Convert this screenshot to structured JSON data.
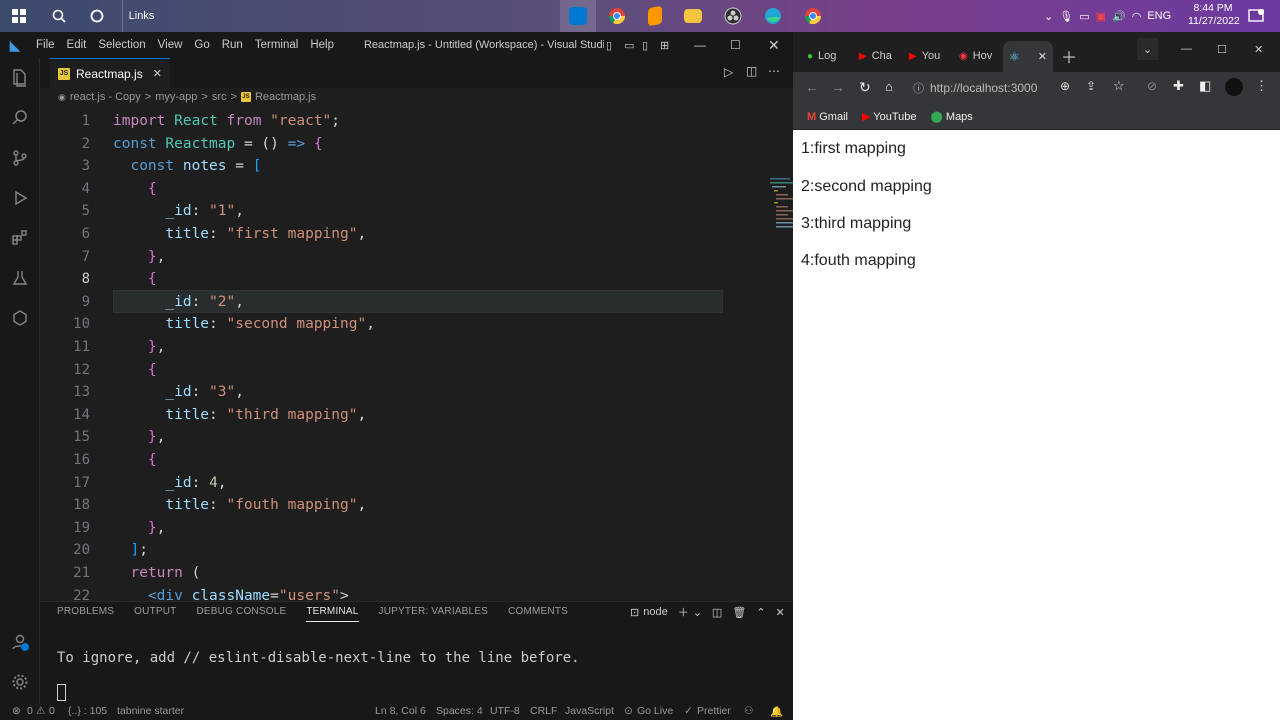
{
  "taskbar": {
    "search_label": "Links",
    "time": "8:44 PM",
    "date": "11/27/2022",
    "lang": "ENG"
  },
  "vscode": {
    "menu": [
      "File",
      "Edit",
      "Selection",
      "View",
      "Go",
      "Run",
      "Terminal",
      "Help"
    ],
    "title": "Reactmap.js - Untitled (Workspace) - Visual Studio C...",
    "tab_label": "Reactmap.js",
    "breadcrumbs": [
      "react.js - Copy",
      ">",
      "myy-app",
      ">",
      "src",
      ">",
      "Reactmap.js"
    ],
    "panel_tabs": [
      "PROBLEMS",
      "OUTPUT",
      "DEBUG CONSOLE",
      "TERMINAL",
      "JUPYTER: VARIABLES",
      "COMMENTS"
    ],
    "terminal_shell": "node",
    "terminal_output": "To ignore, add // eslint-disable-next-line to the line before.",
    "status": {
      "errors": "0",
      "warnings": "0",
      "braces": "{..} : 105",
      "tabnine": "tabnine starter",
      "position": "Ln 8, Col 6",
      "spaces": "Spaces: 4",
      "encoding": "UTF-8",
      "eol": "CRLF",
      "language": "JavaScript",
      "golive": "Go Live",
      "prettier": "Prettier"
    },
    "code_lines": [
      "import React from \"react\";",
      "const Reactmap = () => {",
      "  const notes = [",
      "    {",
      "      _id: \"1\",",
      "      title: \"first mapping\",",
      "    },",
      "    {",
      "      _id: \"2\",",
      "      title: \"second mapping\",",
      "    },",
      "    {",
      "      _id: \"3\",",
      "      title: \"third mapping\",",
      "    },",
      "    {",
      "      _id: 4,",
      "      title: \"fouth mapping\",",
      "    },",
      "  ];",
      "  return (",
      "    <div className=\"users\">"
    ]
  },
  "chrome": {
    "tabs": [
      "Log",
      "Cha",
      "You",
      "Hov",
      ""
    ],
    "url": "http://localhost:3000",
    "bookmarks": [
      "Gmail",
      "YouTube",
      "Maps"
    ],
    "items": [
      "1:first mapping",
      "2:second mapping",
      "3:third mapping",
      "4:fouth mapping"
    ]
  }
}
